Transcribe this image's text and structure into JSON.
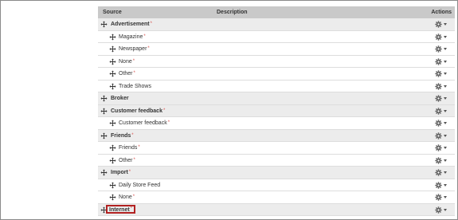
{
  "header": {
    "source": "Source",
    "description": "Description",
    "actions": "Actions"
  },
  "required_marker": "*",
  "colors": {
    "header_bg": "#c9c9c9",
    "group_bg": "#ececec",
    "required": "#d9534f",
    "highlight": "#b22222"
  },
  "rows": [
    {
      "label": "Advertisement",
      "level": "group",
      "required": true
    },
    {
      "label": "Magazine",
      "level": "child",
      "required": true
    },
    {
      "label": "Newspaper",
      "level": "child",
      "required": true
    },
    {
      "label": "None",
      "level": "child",
      "required": true
    },
    {
      "label": "Other",
      "level": "child",
      "required": true
    },
    {
      "label": "Trade Shows",
      "level": "child",
      "required": false
    },
    {
      "label": "Broker",
      "level": "group",
      "required": false
    },
    {
      "label": "Customer feedback",
      "level": "group",
      "required": true
    },
    {
      "label": "Customer feedback",
      "level": "child",
      "required": true
    },
    {
      "label": "Friends",
      "level": "group",
      "required": true
    },
    {
      "label": "Friends",
      "level": "child",
      "required": true
    },
    {
      "label": "Other",
      "level": "child",
      "required": true
    },
    {
      "label": "Import",
      "level": "group",
      "required": true
    },
    {
      "label": "Daily Store Feed",
      "level": "child",
      "required": false
    },
    {
      "label": "None",
      "level": "child",
      "required": true
    },
    {
      "label": "Internet",
      "level": "group",
      "required": true,
      "highlighted": true
    }
  ],
  "icons": {
    "move": "move-arrows-icon",
    "gear": "gear-icon",
    "caret": "chevron-down-icon"
  }
}
